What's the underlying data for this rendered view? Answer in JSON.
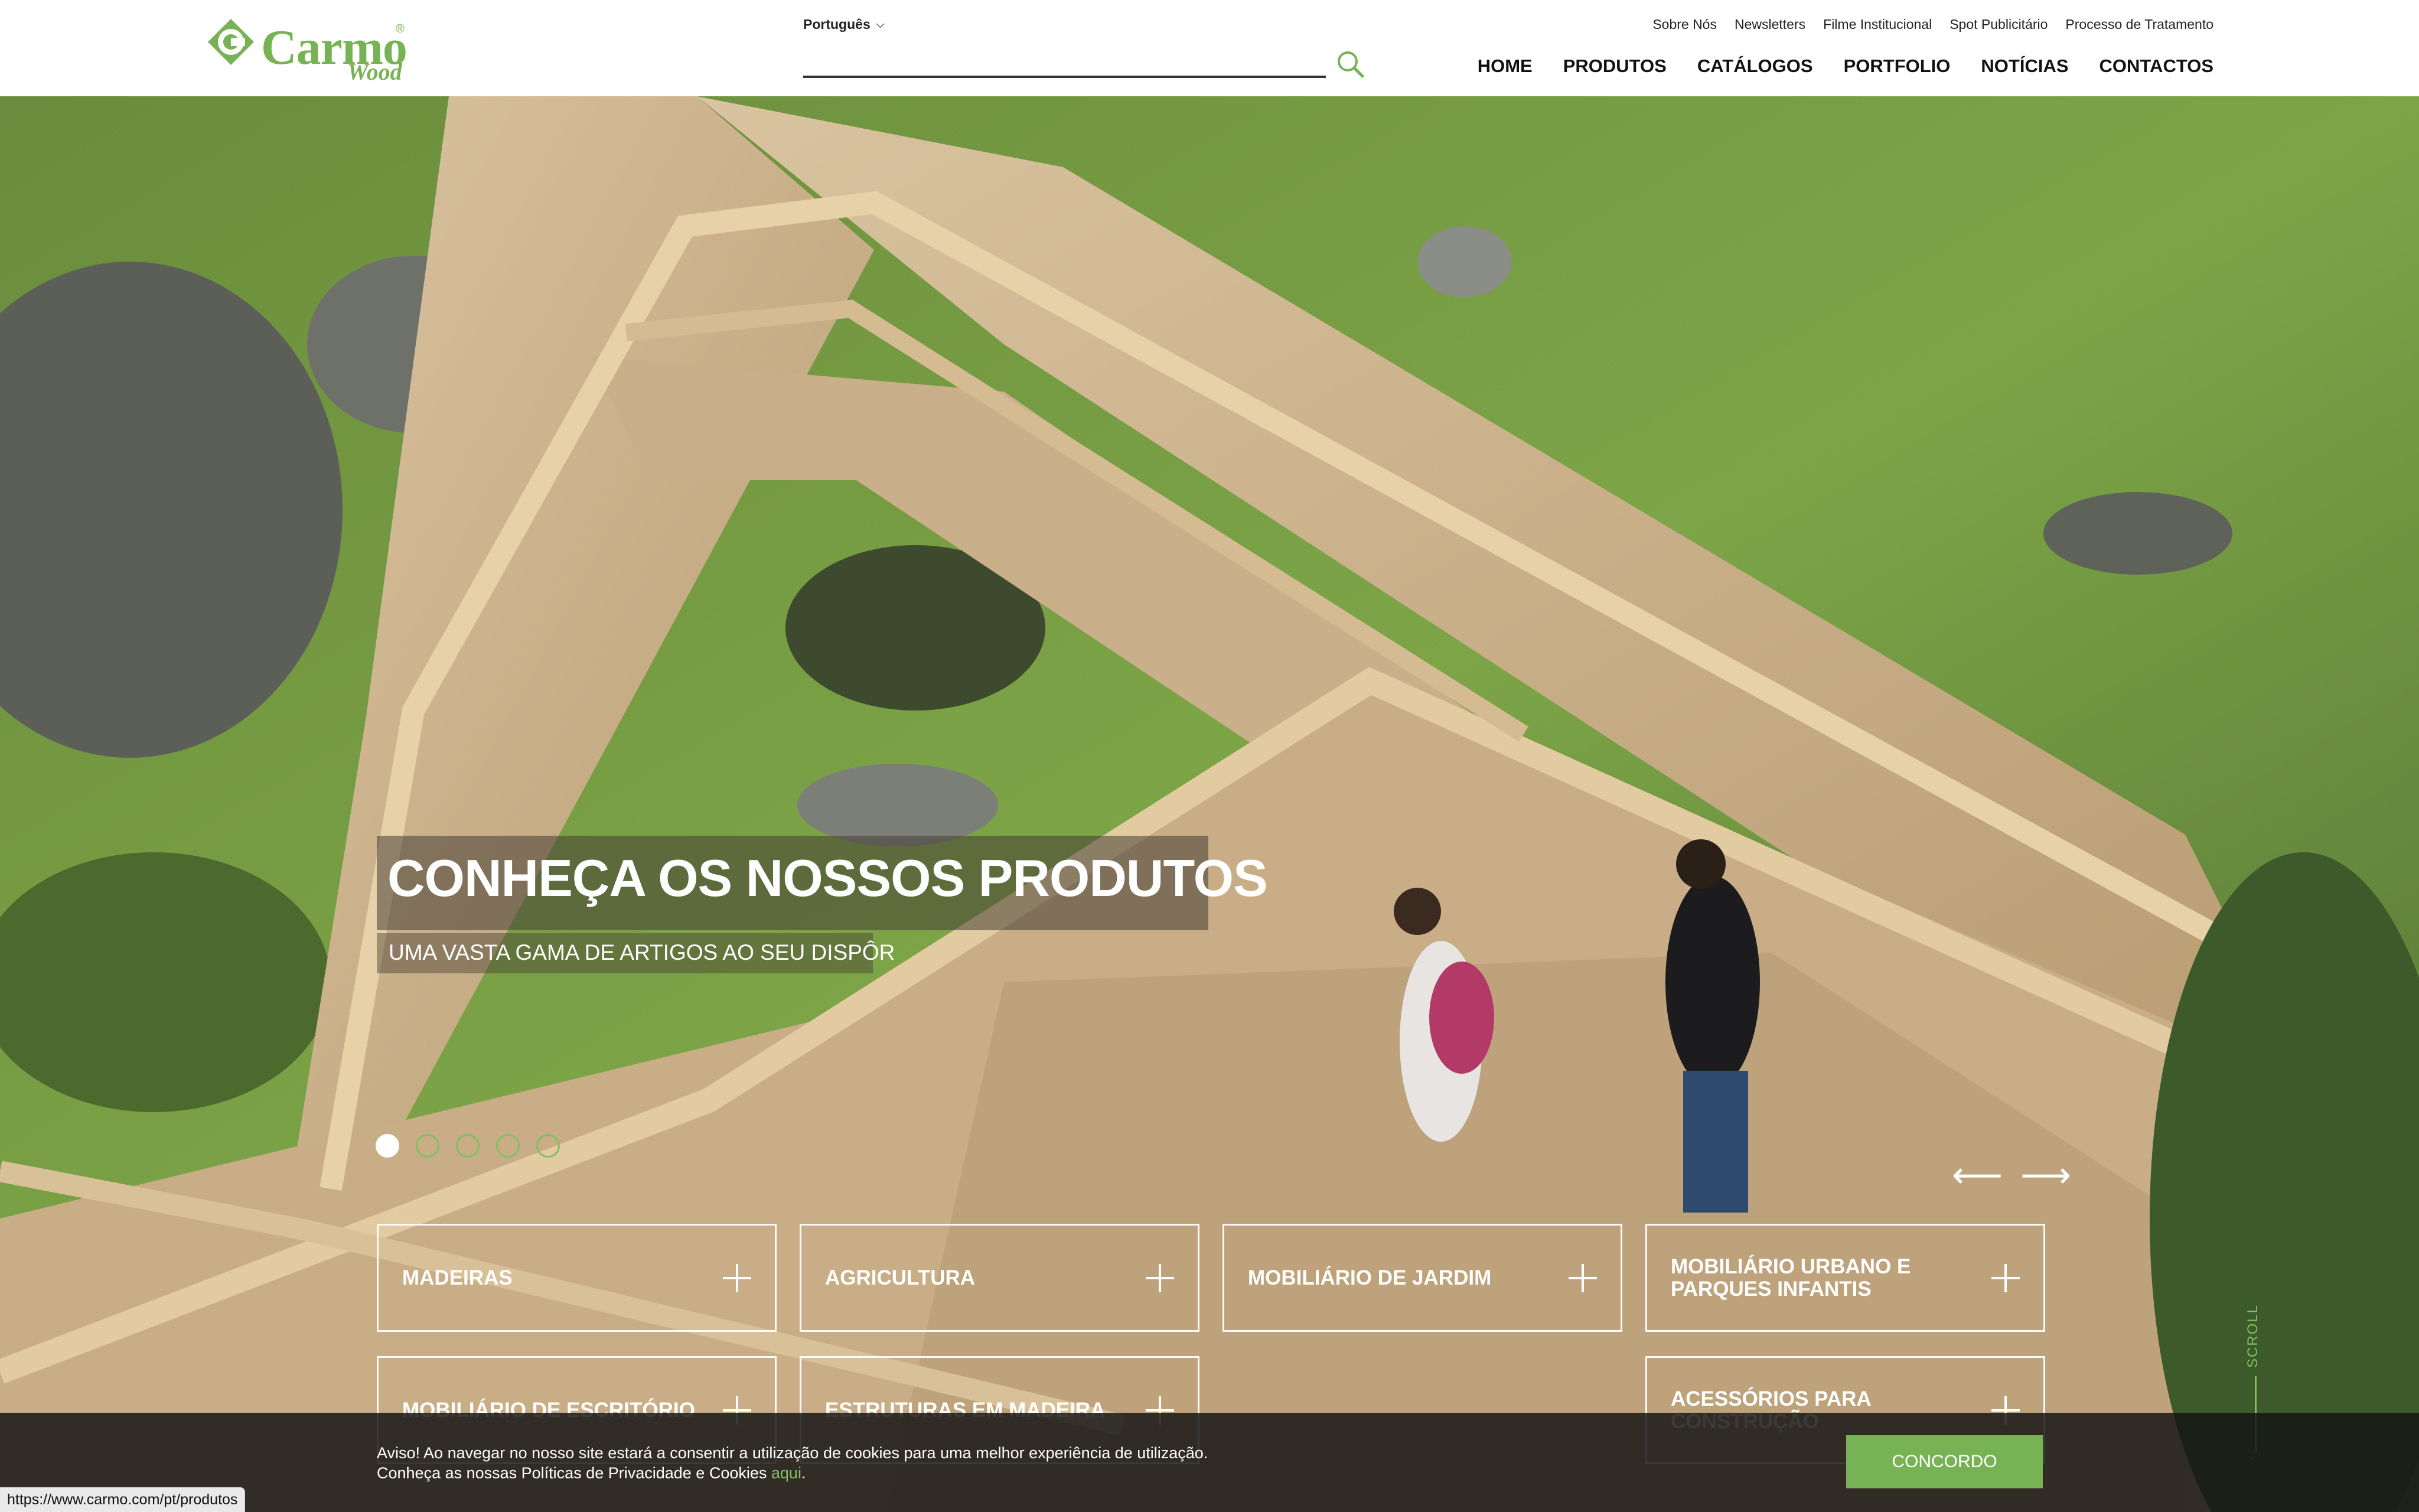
{
  "brand": {
    "name": "Carmo",
    "sub": "Wood",
    "reg": "®"
  },
  "header": {
    "language": "Português",
    "top_links": [
      "Sobre Nós",
      "Newsletters",
      "Filme Institucional",
      "Spot Publicitário",
      "Processo de Tratamento"
    ],
    "nav": [
      "HOME",
      "PRODUTOS",
      "CATÁLOGOS",
      "PORTFOLIO",
      "NOTÍCIAS",
      "CONTACTOS"
    ]
  },
  "hero": {
    "title": "CONHEÇA OS NOSSOS PRODUTOS",
    "subtitle": "UMA VASTA GAMA DE ARTIGOS AO SEU DISPÔR",
    "slide_count": 5,
    "active_slide": 1,
    "prev_arrow": "⟵",
    "next_arrow": "⟶"
  },
  "categories": [
    "MADEIRAS",
    "AGRICULTURA",
    "MOBILIÁRIO DE JARDIM",
    "MOBILIÁRIO URBANO E PARQUES INFANTIS",
    "MOBILIÁRIO DE ESCRITÓRIO",
    "ESTRUTURAS EM MADEIRA",
    "ACESSÓRIOS PARA CONSTRUÇÃO"
  ],
  "scroll_label": "SCROLL",
  "cookie": {
    "line1": "Aviso! Ao navegar no nosso site estará a consentir a utilização de cookies para uma melhor experiência de utilização.",
    "line2": "Conheça as nossas Políticas de Privacidade e Cookies",
    "link": "aqui",
    "after_link": ".",
    "button": "CONCORDO"
  },
  "status_url": "https://www.carmo.com/pt/produtos",
  "colors": {
    "accent": "#77b255",
    "header_bg": "#ffffff",
    "cookie_bg": "#141414"
  },
  "icons": [
    "carmo-logo-icon",
    "search-icon",
    "chevron-down-icon",
    "arrow-left-icon",
    "arrow-right-icon",
    "plus-icon",
    "scroll-down-icon"
  ]
}
